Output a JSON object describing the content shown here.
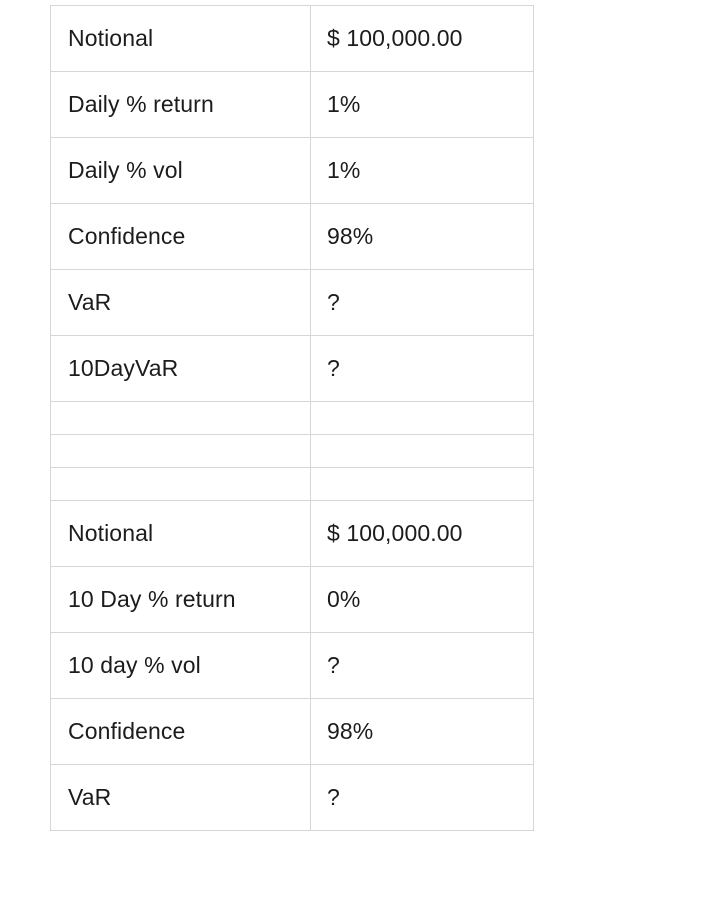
{
  "document": {
    "type": "spreadsheet-table",
    "background_color": "#ffffff",
    "border_color": "#d6d6d6",
    "text_color": "#1c1c1c"
  },
  "table": {
    "columns": [
      "label",
      "value"
    ],
    "rows": [
      {
        "kind": "data",
        "label": "Notional",
        "value": "$ 100,000.00"
      },
      {
        "kind": "data",
        "label": "Daily % return",
        "value": "1%"
      },
      {
        "kind": "data",
        "label": "Daily % vol",
        "value": "1%"
      },
      {
        "kind": "data",
        "label": "Confidence",
        "value": "98%"
      },
      {
        "kind": "data",
        "label": "VaR",
        "value": "?"
      },
      {
        "kind": "data",
        "label": "10DayVaR",
        "value": "?"
      },
      {
        "kind": "spacer",
        "label": "",
        "value": ""
      },
      {
        "kind": "spacer",
        "label": "",
        "value": ""
      },
      {
        "kind": "spacer",
        "label": "",
        "value": ""
      },
      {
        "kind": "data",
        "label": "Notional",
        "value": "$ 100,000.00"
      },
      {
        "kind": "data",
        "label": "10 Day % return",
        "value": "0%"
      },
      {
        "kind": "data",
        "label": "10 day % vol",
        "value": "?"
      },
      {
        "kind": "data",
        "label": "Confidence",
        "value": "98%"
      },
      {
        "kind": "data",
        "label": "VaR",
        "value": "?"
      }
    ]
  }
}
